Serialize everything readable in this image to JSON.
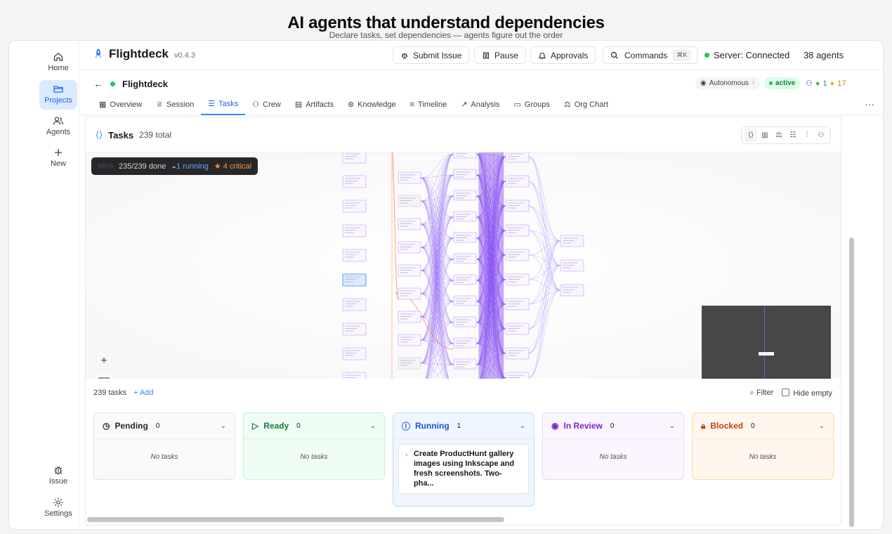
{
  "hero": {
    "title": "AI agents that understand dependencies",
    "subtitle": "Declare tasks, set dependencies — agents figure out the order"
  },
  "sidebar": {
    "items": [
      {
        "label": "Home",
        "icon": "home-icon"
      },
      {
        "label": "Projects",
        "icon": "folder-icon",
        "active": true
      },
      {
        "label": "Agents",
        "icon": "users-icon"
      },
      {
        "label": "New",
        "icon": "plus-icon"
      }
    ],
    "bottom": [
      {
        "label": "Issue",
        "icon": "bug-icon"
      },
      {
        "label": "Settings",
        "icon": "gear-icon"
      }
    ]
  },
  "topbar": {
    "app_name": "Flightdeck",
    "version": "v0.4.3",
    "submit_issue": "Submit Issue",
    "pause": "Pause",
    "approvals": "Approvals",
    "commands": "Commands",
    "commands_shortcut": "⌘K",
    "server_status": "Server: Connected",
    "agents_count": "38 agents"
  },
  "project": {
    "name": "Flightdeck",
    "mode": "Autonomous",
    "status": "active",
    "agent_active": "1",
    "agent_idle": "17"
  },
  "tabs": [
    {
      "label": "Overview",
      "icon": "grid-icon"
    },
    {
      "label": "Session",
      "icon": "crown-icon"
    },
    {
      "label": "Tasks",
      "icon": "checklist-icon",
      "active": true
    },
    {
      "label": "Crew",
      "icon": "users-icon"
    },
    {
      "label": "Artifacts",
      "icon": "file-icon"
    },
    {
      "label": "Knowledge",
      "icon": "brain-icon"
    },
    {
      "label": "Timeline",
      "icon": "timeline-icon"
    },
    {
      "label": "Analysis",
      "icon": "trend-icon"
    },
    {
      "label": "Groups",
      "icon": "chat-icon"
    },
    {
      "label": "Org Chart",
      "icon": "org-chart-icon"
    }
  ],
  "tasks": {
    "title": "Tasks",
    "total": "239 total",
    "stats": {
      "percent": "98%",
      "done": "235/239 done",
      "running": "1 running",
      "critical": "4 critical"
    },
    "list_count": "239 tasks",
    "add_label": "+ Add",
    "filter_label": "Filter",
    "hide_empty_label": "Hide empty"
  },
  "kanban": [
    {
      "title": "Pending",
      "count": "0",
      "empty": "No tasks",
      "color": "#fafafa",
      "border": "#e4e4e7",
      "text": "#27272a"
    },
    {
      "title": "Ready",
      "count": "0",
      "empty": "No tasks",
      "color": "#f0fdf4",
      "border": "#bbf7d0",
      "text": "#15803d"
    },
    {
      "title": "Running",
      "count": "1",
      "color": "#eff6ff",
      "border": "#bfdbfe",
      "text": "#1d4ed8",
      "cards": [
        "Create ProductHunt gallery images using Inkscape and fresh screenshots. Two-pha..."
      ]
    },
    {
      "title": "In Review",
      "count": "0",
      "empty": "No tasks",
      "color": "#faf5ff",
      "border": "#e9d5ff",
      "text": "#7e22ce"
    },
    {
      "title": "Blocked",
      "count": "0",
      "empty": "No tasks",
      "color": "#fff7ed",
      "border": "#fed7aa",
      "text": "#c2410c"
    }
  ]
}
